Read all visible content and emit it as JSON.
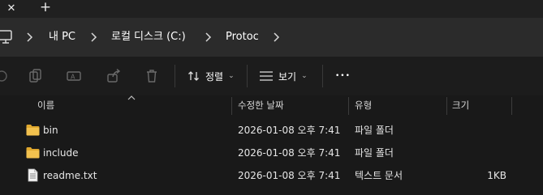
{
  "tabs": {
    "close_glyph": "✕",
    "new_tab_glyph": "+"
  },
  "breadcrumb": [
    "내 PC",
    "로컬 디스크 (C:)",
    "Protoc"
  ],
  "toolbar": {
    "sort_label": "정렬",
    "view_label": "보기",
    "more_glyph": "•••"
  },
  "columns": {
    "name": "이름",
    "modified": "수정한 날짜",
    "type": "유형",
    "size": "크기"
  },
  "files": [
    {
      "name": "bin",
      "modified": "2026-01-08 오후 7:41",
      "type": "파일 폴더",
      "size": "",
      "icon": "folder-icon"
    },
    {
      "name": "include",
      "modified": "2026-01-08 오후 7:41",
      "type": "파일 폴더",
      "size": "",
      "icon": "folder-icon"
    },
    {
      "name": "readme.txt",
      "modified": "2026-01-08 오후 7:41",
      "type": "텍스트 문서",
      "size": "1KB",
      "icon": "text-file-icon"
    }
  ],
  "colors": {
    "background": "#191919",
    "address_bar": "#2b2b2b",
    "folder": "#e8b339"
  }
}
